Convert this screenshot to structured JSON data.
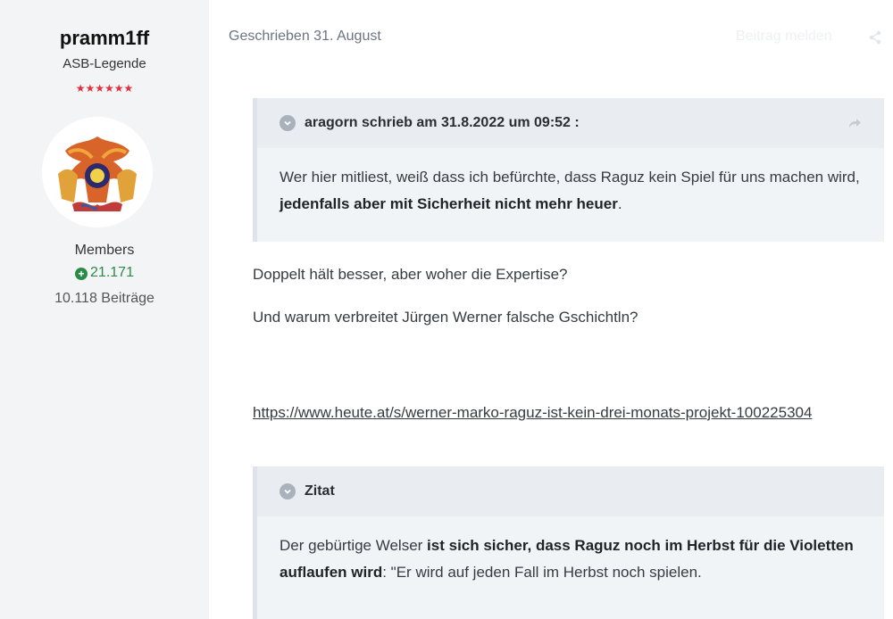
{
  "author": {
    "name": "pramm1ff",
    "title": "ASB-Legende",
    "stars": "★★★★★★",
    "group": "Members",
    "reputation": "21.171",
    "posts": "10.118 Beiträge",
    "rep_color": "#2b8a4a",
    "stars_color": "#e0313c"
  },
  "post": {
    "meta": "Geschrieben 31. August",
    "report_label": "Beitrag melden",
    "quote1": {
      "header": "aragorn schrieb am 31.8.2022 um 09:52 :",
      "text_before": "Wer hier mitliest, weiß dass ich befürchte, dass Raguz kein Spiel für uns machen wird, ",
      "text_bold": "jedenfalls aber mit Sicherheit nicht mehr heuer",
      "text_after": "."
    },
    "paragraph1": "Doppelt hält besser, aber woher die Expertise?",
    "paragraph2": "Und warum verbreitet Jürgen Werner falsche Gschichtln?",
    "link": "https://www.heute.at/s/werner-marko-raguz-ist-kein-drei-monats-projekt-100225304",
    "quote2": {
      "header": "Zitat",
      "text_before": "Der gebürtige Welser ",
      "text_bold1": "ist sich sicher, dass Raguz noch im Herbst für die Violetten auflaufen wird",
      "text_after": ": \"Er wird auf jeden Fall im Herbst noch spielen."
    }
  }
}
